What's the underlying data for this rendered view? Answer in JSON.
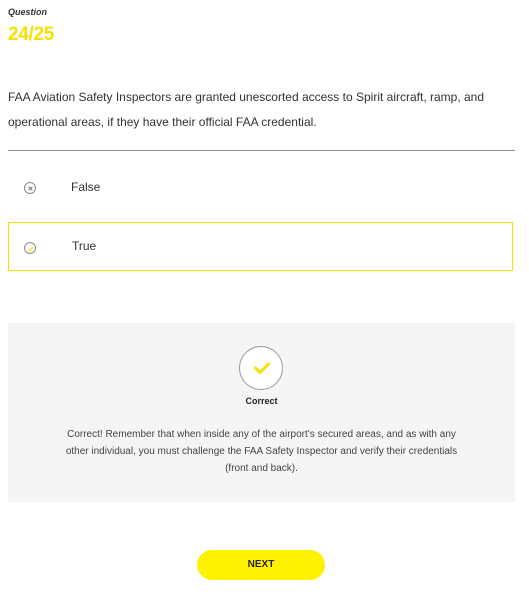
{
  "question": {
    "label": "Question",
    "counter": "24/25",
    "text": "FAA Aviation Safety Inspectors are granted unescorted access to Spirit aircraft, ramp, and operational areas, if they have their official FAA credential."
  },
  "options": [
    {
      "label": "False",
      "icon": "close-circle-icon",
      "selected": false
    },
    {
      "label": "True",
      "icon": "check-circle-icon",
      "selected": true
    }
  ],
  "feedback": {
    "icon": "check-icon",
    "title": "Correct",
    "text": "Correct! Remember that when inside any of the airport's secured areas, and as with any other individual, you must challenge the FAA Safety Inspector and verify their credentials (front and back)."
  },
  "actions": {
    "next_label": "NEXT"
  },
  "colors": {
    "accent": "#f8e000",
    "button": "#fff200",
    "feedback_bg": "#f5f5f5"
  }
}
